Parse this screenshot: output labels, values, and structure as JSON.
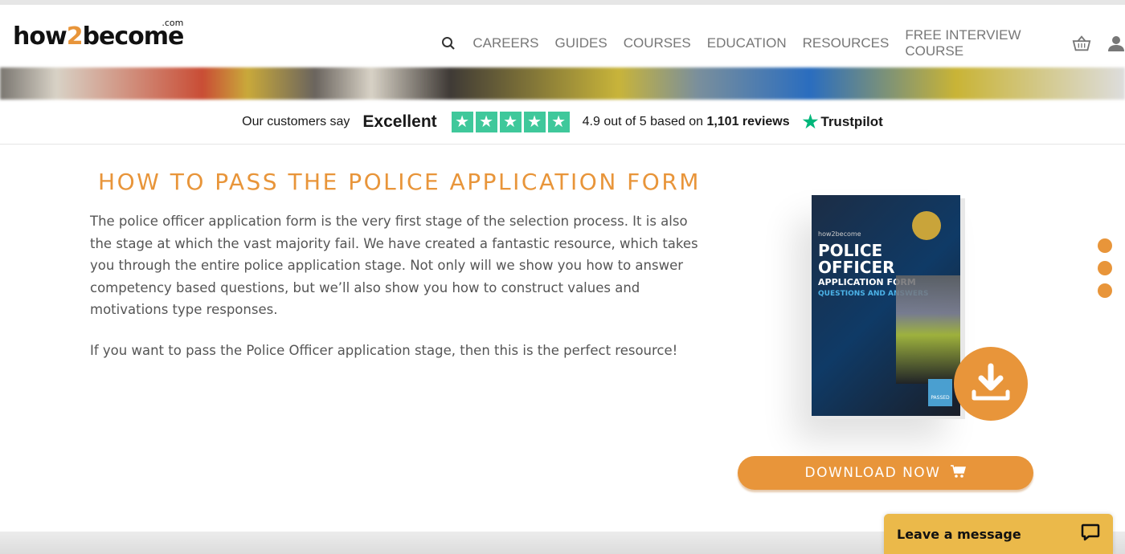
{
  "header": {
    "logo": {
      "pre": "how",
      "two": "2",
      "post": "become",
      "com": ".com"
    },
    "nav": [
      "CAREERS",
      "GUIDES",
      "COURSES",
      "EDUCATION",
      "RESOURCES",
      "FREE INTERVIEW COURSE"
    ],
    "icons": [
      "search-icon",
      "basket-icon",
      "user-icon"
    ]
  },
  "trustpilot": {
    "say": "Our customers say",
    "rating_word": "Excellent",
    "stars": 5,
    "reviews_text": "4.9 out of 5 based on ",
    "reviews_count": "1,101",
    "reviews_suffix": " reviews",
    "brand": "Trustpilot"
  },
  "main": {
    "title": "HOW TO PASS THE POLICE APPLICATION FORM",
    "paragraphs": [
      "The police officer application form is the very first stage of the selection process. It is also the stage at which the vast majority fail. We have created a fantastic resource, which takes you through the entire police application stage. Not only will we show you how to answer competency based questions, but we’ll also show you how to construct values and motivations type responses.",
      "If you want to pass the Police Officer application stage, then this is the perfect resource!"
    ],
    "book": {
      "brand": "how2become",
      "title1": "POLICE OFFICER",
      "title2": "APPLICATION FORM",
      "title3": "QUESTIONS AND ANSWERS",
      "badge": "PASSED"
    },
    "download_label": "DOWNLOAD NOW"
  },
  "chat": {
    "label": "Leave a message"
  },
  "colors": {
    "accent": "#e8953a",
    "trustpilot": "#00b67a",
    "chat": "#ebb94a"
  }
}
